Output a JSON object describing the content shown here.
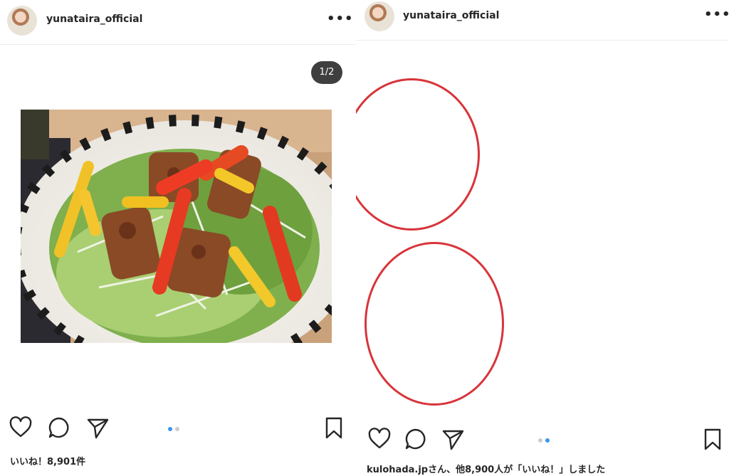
{
  "left_post": {
    "username": "yunataira_official",
    "more_icon": "•••",
    "page_indicator": "1/2",
    "likes_text": "いいね！8,901件",
    "carousel": {
      "count": 2,
      "active": 0
    }
  },
  "right_post": {
    "username": "yunataira_official",
    "more_icon": "•••",
    "likes_user": "kulohada.jp",
    "likes_rest": "さん、他8,900人が「いいね！」しました",
    "carousel": {
      "count": 2,
      "active": 1
    }
  },
  "colors": {
    "accent": "#3897f0",
    "annotation": "#d8343a",
    "text": "#262626"
  }
}
